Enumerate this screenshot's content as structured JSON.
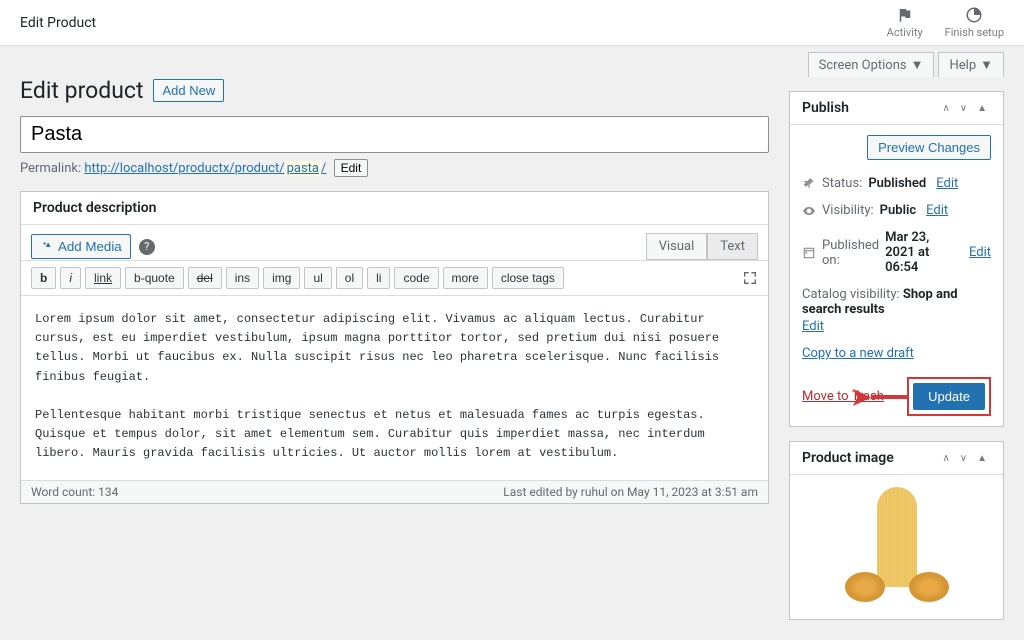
{
  "adminBar": {
    "title": "Edit Product",
    "activity": "Activity",
    "finishSetup": "Finish setup"
  },
  "screenOptions": {
    "screenOptions": "Screen Options",
    "help": "Help"
  },
  "page": {
    "heading": "Edit product",
    "addNew": "Add New"
  },
  "title": {
    "value": "Pasta"
  },
  "permalink": {
    "label": "Permalink:",
    "base": "http://localhost/productx/product/",
    "slug": "pasta",
    "tail": "/",
    "edit": "Edit"
  },
  "editor": {
    "boxTitle": "Product description",
    "addMedia": "Add Media",
    "tabs": {
      "visual": "Visual",
      "text": "Text"
    },
    "qt": {
      "b": "b",
      "i": "i",
      "link": "link",
      "bquote": "b-quote",
      "del": "del",
      "ins": "ins",
      "img": "img",
      "ul": "ul",
      "ol": "ol",
      "li": "li",
      "code": "code",
      "more": "more",
      "closetags": "close tags"
    },
    "content": "Lorem ipsum dolor sit amet, consectetur adipiscing elit. Vivamus ac aliquam lectus. Curabitur cursus, est eu imperdiet vestibulum, ipsum magna porttitor tortor, sed pretium dui nisi posuere tellus. Morbi ut faucibus ex. Nulla suscipit risus nec leo pharetra scelerisque. Nunc facilisis finibus feugiat.\n\nPellentesque habitant morbi tristique senectus et netus et malesuada fames ac turpis egestas. Quisque et tempus dolor, sit amet elementum sem. Curabitur quis imperdiet massa, nec interdum libero. Mauris gravida facilisis ultricies. Ut auctor mollis lorem at vestibulum.\n\nInteger neque dolor, ultrices non purus a, maximus malesuada odio. Etiam pharetra lacus eu arcu commodo dictum. Phasellus eleifend erat quis hendrerit dictum. Donec feugiat in arcu nec dictum. Sed bibendum venenatis arcu id posuere. Suspendisse ac tempus massa, id congue justo. Etiam diam neque, eget orci vehicula sollicitudin. Curabitur ac pharetra neque.",
    "wordCount": "Word count: 134",
    "lastEdited": "Last edited by ruhul on May 11, 2023 at 3:51 am"
  },
  "publish": {
    "title": "Publish",
    "preview": "Preview Changes",
    "statusLabel": "Status:",
    "status": "Published",
    "editLink": "Edit",
    "visibilityLabel": "Visibility:",
    "visibility": "Public",
    "publishedLabel": "Published on:",
    "publishedDate": "Mar 23, 2021 at 06:54",
    "catalogLabel": "Catalog visibility:",
    "catalogValue": "Shop and search results",
    "copy": "Copy to a new draft",
    "trash": "Move to Trash",
    "update": "Update"
  },
  "productImage": {
    "title": "Product image"
  }
}
